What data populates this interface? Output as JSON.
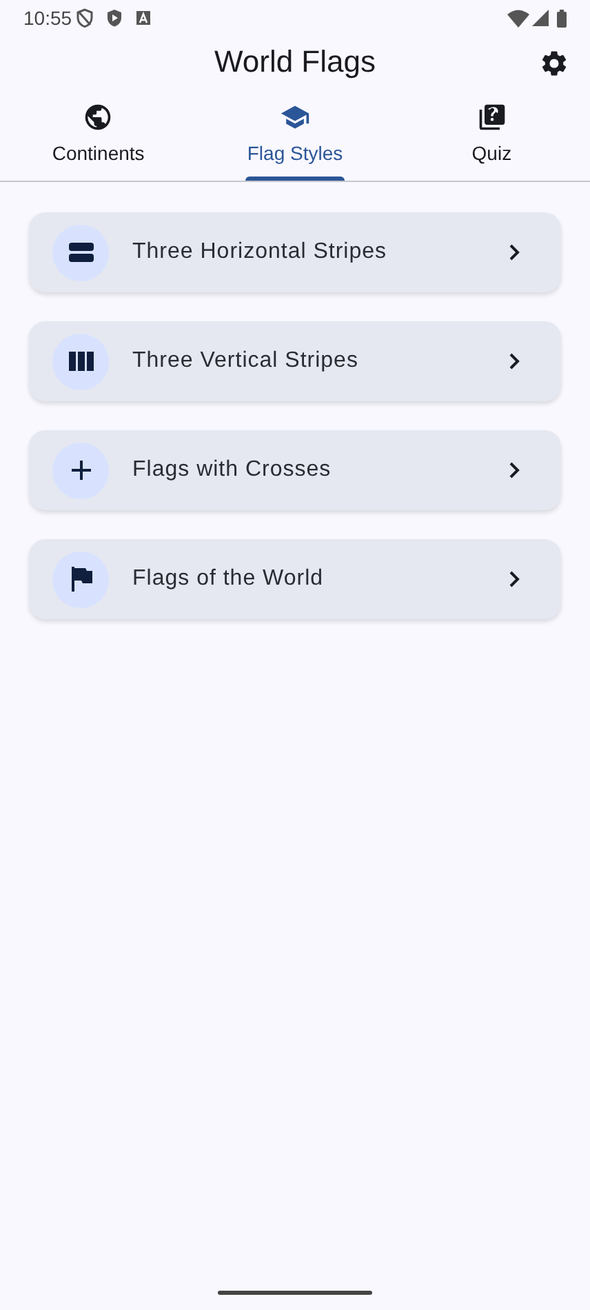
{
  "status_bar": {
    "time": "10:55"
  },
  "app_bar": {
    "title": "World Flags"
  },
  "tabs": [
    {
      "label": "Continents",
      "selected": false
    },
    {
      "label": "Flag Styles",
      "selected": true
    },
    {
      "label": "Quiz",
      "selected": false
    }
  ],
  "items": [
    {
      "label": "Three Horizontal Stripes"
    },
    {
      "label": "Three Vertical Stripes"
    },
    {
      "label": "Flags with Crosses"
    },
    {
      "label": "Flags of the World"
    }
  ]
}
